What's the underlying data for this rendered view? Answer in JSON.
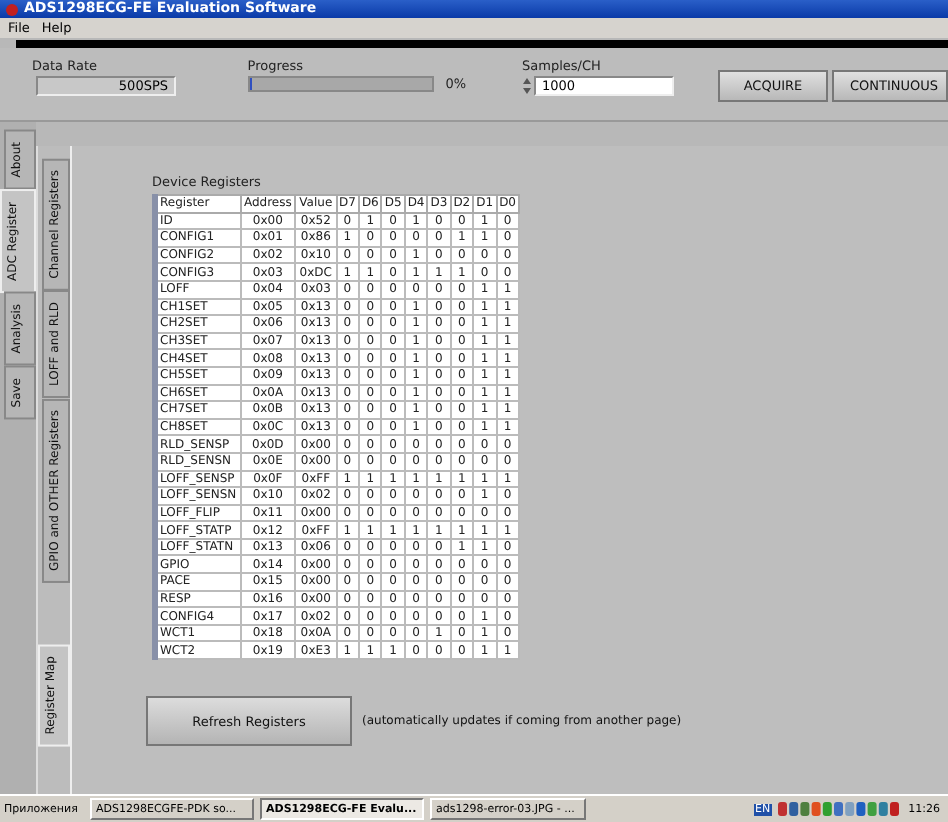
{
  "window": {
    "title": "ADS1298ECG-FE Evaluation Software"
  },
  "menu": [
    "File",
    "Help"
  ],
  "controls": {
    "data_rate": {
      "label": "Data Rate",
      "value": "500SPS"
    },
    "progress": {
      "label": "Progress",
      "level": 0.01,
      "reading": "0%"
    },
    "samples": {
      "label": "Samples/CH",
      "value": "1000"
    },
    "buttons": [
      "ACQUIRE",
      "CONTINUOUS"
    ]
  },
  "main_tabs": [
    {
      "label": "About",
      "selected": false
    },
    {
      "label": "ADC Register",
      "selected": true
    },
    {
      "label": "Analysis",
      "selected": false
    },
    {
      "label": "Save",
      "selected": false
    }
  ],
  "sub_tabs": [
    {
      "label": "Channel Registers",
      "selected": false
    },
    {
      "label": "LOFF and RLD",
      "selected": false
    },
    {
      "label": "GPIO and OTHER Registers",
      "selected": false
    },
    {
      "label": "Register Map",
      "selected": true
    }
  ],
  "registers": {
    "title": "Device Registers",
    "columns": [
      "Register",
      "Address",
      "Value",
      "D7",
      "D6",
      "D5",
      "D4",
      "D3",
      "D2",
      "D1",
      "D0"
    ],
    "rows": [
      {
        "name": "ID",
        "address": "0x00",
        "value": "0x52",
        "bits": [
          "0",
          "1",
          "0",
          "1",
          "0",
          "0",
          "1",
          "0"
        ]
      },
      {
        "name": "CONFIG1",
        "address": "0x01",
        "value": "0x86",
        "bits": [
          "1",
          "0",
          "0",
          "0",
          "0",
          "1",
          "1",
          "0"
        ]
      },
      {
        "name": "CONFIG2",
        "address": "0x02",
        "value": "0x10",
        "bits": [
          "0",
          "0",
          "0",
          "1",
          "0",
          "0",
          "0",
          "0"
        ]
      },
      {
        "name": "CONFIG3",
        "address": "0x03",
        "value": "0xDC",
        "bits": [
          "1",
          "1",
          "0",
          "1",
          "1",
          "1",
          "0",
          "0"
        ]
      },
      {
        "name": "LOFF",
        "address": "0x04",
        "value": "0x03",
        "bits": [
          "0",
          "0",
          "0",
          "0",
          "0",
          "0",
          "1",
          "1"
        ]
      },
      {
        "name": "CH1SET",
        "address": "0x05",
        "value": "0x13",
        "bits": [
          "0",
          "0",
          "0",
          "1",
          "0",
          "0",
          "1",
          "1"
        ]
      },
      {
        "name": "CH2SET",
        "address": "0x06",
        "value": "0x13",
        "bits": [
          "0",
          "0",
          "0",
          "1",
          "0",
          "0",
          "1",
          "1"
        ]
      },
      {
        "name": "CH3SET",
        "address": "0x07",
        "value": "0x13",
        "bits": [
          "0",
          "0",
          "0",
          "1",
          "0",
          "0",
          "1",
          "1"
        ]
      },
      {
        "name": "CH4SET",
        "address": "0x08",
        "value": "0x13",
        "bits": [
          "0",
          "0",
          "0",
          "1",
          "0",
          "0",
          "1",
          "1"
        ]
      },
      {
        "name": "CH5SET",
        "address": "0x09",
        "value": "0x13",
        "bits": [
          "0",
          "0",
          "0",
          "1",
          "0",
          "0",
          "1",
          "1"
        ]
      },
      {
        "name": "CH6SET",
        "address": "0x0A",
        "value": "0x13",
        "bits": [
          "0",
          "0",
          "0",
          "1",
          "0",
          "0",
          "1",
          "1"
        ]
      },
      {
        "name": "CH7SET",
        "address": "0x0B",
        "value": "0x13",
        "bits": [
          "0",
          "0",
          "0",
          "1",
          "0",
          "0",
          "1",
          "1"
        ]
      },
      {
        "name": "CH8SET",
        "address": "0x0C",
        "value": "0x13",
        "bits": [
          "0",
          "0",
          "0",
          "1",
          "0",
          "0",
          "1",
          "1"
        ]
      },
      {
        "name": "RLD_SENSP",
        "address": "0x0D",
        "value": "0x00",
        "bits": [
          "0",
          "0",
          "0",
          "0",
          "0",
          "0",
          "0",
          "0"
        ]
      },
      {
        "name": "RLD_SENSN",
        "address": "0x0E",
        "value": "0x00",
        "bits": [
          "0",
          "0",
          "0",
          "0",
          "0",
          "0",
          "0",
          "0"
        ]
      },
      {
        "name": "LOFF_SENSP",
        "address": "0x0F",
        "value": "0xFF",
        "bits": [
          "1",
          "1",
          "1",
          "1",
          "1",
          "1",
          "1",
          "1"
        ]
      },
      {
        "name": "LOFF_SENSN",
        "address": "0x10",
        "value": "0x02",
        "bits": [
          "0",
          "0",
          "0",
          "0",
          "0",
          "0",
          "1",
          "0"
        ]
      },
      {
        "name": "LOFF_FLIP",
        "address": "0x11",
        "value": "0x00",
        "bits": [
          "0",
          "0",
          "0",
          "0",
          "0",
          "0",
          "0",
          "0"
        ]
      },
      {
        "name": "LOFF_STATP",
        "address": "0x12",
        "value": "0xFF",
        "bits": [
          "1",
          "1",
          "1",
          "1",
          "1",
          "1",
          "1",
          "1"
        ]
      },
      {
        "name": "LOFF_STATN",
        "address": "0x13",
        "value": "0x06",
        "bits": [
          "0",
          "0",
          "0",
          "0",
          "0",
          "1",
          "1",
          "0"
        ]
      },
      {
        "name": "GPIO",
        "address": "0x14",
        "value": "0x00",
        "bits": [
          "0",
          "0",
          "0",
          "0",
          "0",
          "0",
          "0",
          "0"
        ]
      },
      {
        "name": "PACE",
        "address": "0x15",
        "value": "0x00",
        "bits": [
          "0",
          "0",
          "0",
          "0",
          "0",
          "0",
          "0",
          "0"
        ]
      },
      {
        "name": "RESP",
        "address": "0x16",
        "value": "0x00",
        "bits": [
          "0",
          "0",
          "0",
          "0",
          "0",
          "0",
          "0",
          "0"
        ]
      },
      {
        "name": "CONFIG4",
        "address": "0x17",
        "value": "0x02",
        "bits": [
          "0",
          "0",
          "0",
          "0",
          "0",
          "0",
          "1",
          "0"
        ]
      },
      {
        "name": "WCT1",
        "address": "0x18",
        "value": "0x0A",
        "bits": [
          "0",
          "0",
          "0",
          "0",
          "1",
          "0",
          "1",
          "0"
        ]
      },
      {
        "name": "WCT2",
        "address": "0x19",
        "value": "0xE3",
        "bits": [
          "1",
          "1",
          "1",
          "0",
          "0",
          "0",
          "1",
          "1"
        ]
      }
    ]
  },
  "refresh": {
    "button": "Refresh Registers",
    "note": "(automatically updates if coming from another page)"
  },
  "taskbar": {
    "start": "Приложения",
    "tasks": [
      {
        "label": "ADS1298ECGFE-PDK so...",
        "selected": false
      },
      {
        "label": "ADS1298ECG-FE Evalu...",
        "selected": true
      },
      {
        "label": "ads1298-error-03.JPG - ...",
        "selected": false
      }
    ],
    "language": "EN",
    "time": "11:26"
  }
}
